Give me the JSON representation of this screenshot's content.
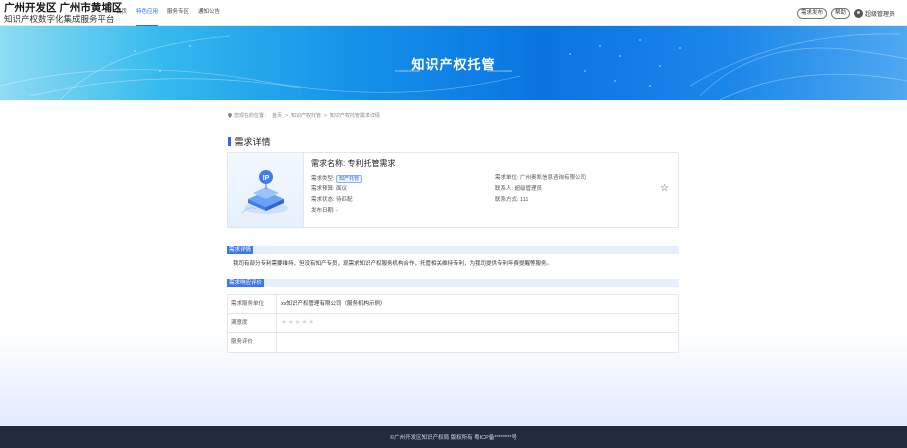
{
  "header": {
    "title_line1": "广州开发区 广州市黄埔区",
    "title_line2": "知识产权数字化集成服务平台",
    "nav": [
      "首页",
      "特色应用",
      "服务专区",
      "通知公告"
    ],
    "actions": {
      "publish": "需求发布",
      "help": "帮助",
      "user": "超级管理员"
    }
  },
  "banner": {
    "title": "知识产权托管"
  },
  "breadcrumb": {
    "prefix": "您现在的位置：",
    "items": [
      "首页",
      "知识产权托管",
      "知识产权托管需求详情"
    ]
  },
  "section_title": "需求详情",
  "card": {
    "title": "需求名称: 专利托管需求",
    "type_label": "需求类型:",
    "type_tag": "知产托管",
    "budget": "需求预算: 面议",
    "status": "需求状态: 待匹配",
    "date": "发布日期: -",
    "org": "需求单位: 广州奥凯信息咨询有限公司",
    "contact": "联系人: 超级管理员",
    "phone": "联系方式: 111"
  },
  "detail_band": "需求详情",
  "detail_text": "我司有部分专利需要维持，但没有知产专员，现需求知识产权服务机构合作，托管相关维持专利，为我司提供专利年费提醒等服务。",
  "eval_band": "需求响应评价",
  "eval_table": [
    {
      "label": "需求服务单位",
      "value": "xx知识产权管理有限公司（服务机构示例）"
    },
    {
      "label": "满意度",
      "value": "★★★★★"
    },
    {
      "label": "服务评价",
      "value": ""
    }
  ],
  "footer": "©广州开发区知识产权局 版权所有 粤ICP备********号",
  "colors": {
    "accent": "#2a6bf2",
    "footer_bg": "#232b3f",
    "band_bg": "#e7efff",
    "band_label": "#3c78ee"
  }
}
